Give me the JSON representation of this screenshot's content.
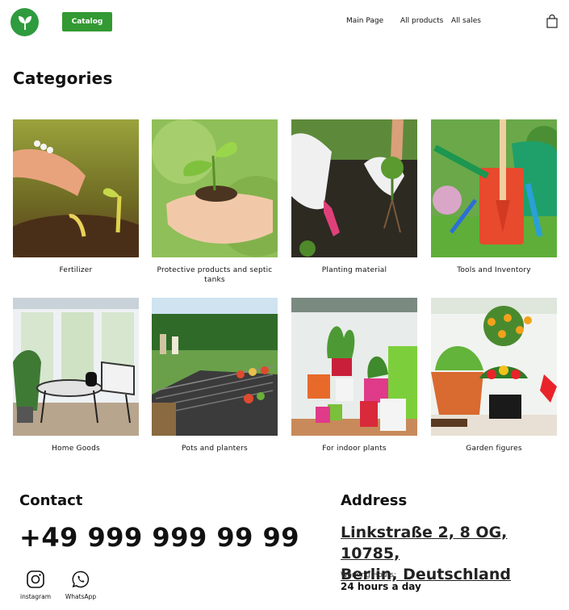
{
  "header": {
    "catalog_label": "Catalog",
    "nav": [
      "Main Page",
      "All products",
      "All sales"
    ],
    "logo_icon": "leaf-icon",
    "cart_icon": "shopping-bag-icon",
    "accent_color": "#339933"
  },
  "page_title": "Categories",
  "categories": [
    {
      "label": "Fertilizer"
    },
    {
      "label": "Protective products and septic tanks"
    },
    {
      "label": "Planting material"
    },
    {
      "label": "Tools and Inventory"
    },
    {
      "label": "Home Goods"
    },
    {
      "label": "Pots and planters"
    },
    {
      "label": "For indoor plants"
    },
    {
      "label": "Garden figures"
    }
  ],
  "contact": {
    "heading": "Contact",
    "phone": "+49 999 999 99 99",
    "socials": [
      {
        "label": "instagram",
        "icon": "instagram-icon"
      },
      {
        "label": "WhatsApp",
        "icon": "whatsapp-icon"
      }
    ]
  },
  "address": {
    "heading": "Address",
    "line1": "Linkstraße 2, 8 OG, 10785,",
    "line2": "Berlin, Deutschland",
    "working_hours_label": "Working Hours:",
    "working_hours_value": "24 hours a day"
  }
}
